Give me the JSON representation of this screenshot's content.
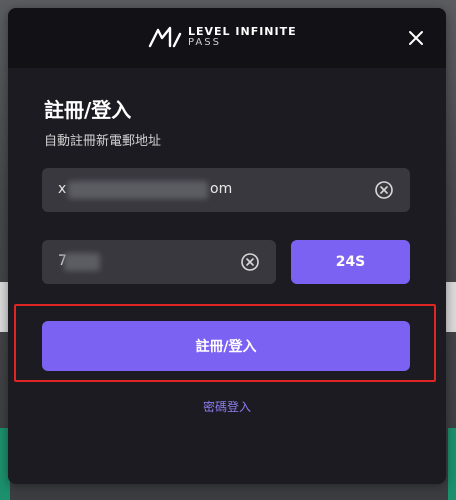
{
  "brand": {
    "line1": "LEVEL INFINITE",
    "line2": "PASS"
  },
  "form": {
    "title": "註冊/登入",
    "subtitle": "自動註冊新電郵地址",
    "email": {
      "value_prefix": "x",
      "value_suffix": "om",
      "placeholder": ""
    },
    "code": {
      "value": "7"
    },
    "resend_label": "24S",
    "submit_label": "註冊/登入",
    "password_login_link": "密碼登入"
  },
  "colors": {
    "accent": "#7b62f2",
    "highlight": "#e02525",
    "modal_bg": "#1c1b21",
    "field_bg": "#39383f"
  }
}
